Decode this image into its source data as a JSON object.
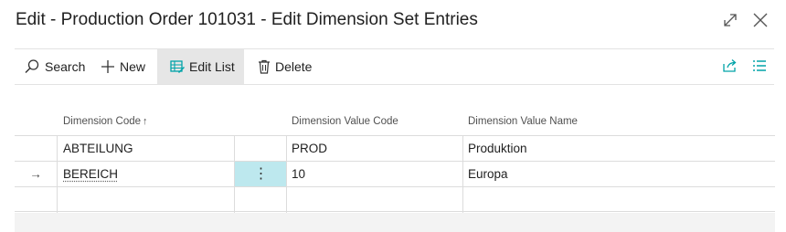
{
  "window": {
    "title": "Edit - Production Order 101031 - Edit Dimension Set Entries",
    "expand_icon": "expand-icon",
    "close_icon": "close-icon"
  },
  "toolbar": {
    "search_label": "Search",
    "new_label": "New",
    "edit_list_label": "Edit List",
    "delete_label": "Delete",
    "share_icon": "share-icon",
    "list_view_icon": "list-view-icon"
  },
  "table": {
    "columns": {
      "dimension_code": "Dimension Code",
      "sort_indicator": "↑",
      "dimension_value_code": "Dimension Value Code",
      "dimension_value_name": "Dimension Value Name"
    },
    "rows": [
      {
        "indicator": "",
        "dimension_code": "ABTEILUNG",
        "dimension_value_code": "PROD",
        "dimension_value_name": "Produktion"
      },
      {
        "indicator": "→",
        "dimension_code": "BEREICH",
        "dimension_value_code": "10",
        "dimension_value_name": "Europa",
        "menu": "⋮"
      },
      {
        "indicator": "",
        "dimension_code": "",
        "dimension_value_code": "",
        "dimension_value_name": ""
      }
    ]
  },
  "colors": {
    "accent_teal": "#00a3a8",
    "active_button_bg": "#e6e6e6",
    "selected_cell_bg": "#bde8ee"
  }
}
